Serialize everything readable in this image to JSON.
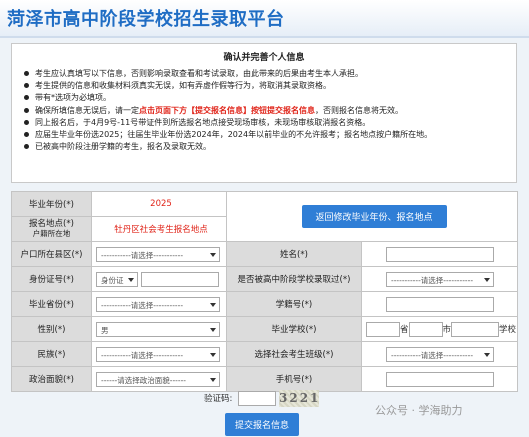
{
  "header": {
    "title": "菏泽市高中阶段学校招生录取平台"
  },
  "notice": {
    "title": "确认并完善个人信息",
    "items": [
      {
        "text": "考生应认真填写以下信息，否则影响录取查看和考试录取，由此带来的后果由考生本人承担。"
      },
      {
        "text": "考生提供的信息和收集材料须真实无误，如有弄虚作假等行为，将取消其录取资格。"
      },
      {
        "text": "带有*选项为必填项。"
      },
      {
        "pre": "确保所填信息无误后，请一定",
        "highlight": "点击页面下方【提交报名信息】按钮提交报名信息",
        "post": "，否则报名信息将无效。"
      },
      {
        "text": "同上报名后，于4月9号-11号带证件到所选报名地点接受现场审核，未现场审核取消报名资格。"
      },
      {
        "text": "应届生毕业年份选2025；往届生毕业年份选2024年，2024年以前毕业的不允许报考；报名地点按户籍所在地。"
      },
      {
        "text": "已被高中阶段注册学籍的考生，报名及录取无效。"
      }
    ]
  },
  "form": {
    "grad_year_label": "毕业年份(*)",
    "grad_year_value": "2025",
    "site_label": "报名地点(*)",
    "site_sub": "户籍所在地",
    "site_value": "牡丹区社会考生报名地点",
    "back_button": "返回修改毕业年份、报名地点",
    "hukou_label": "户口所在县区(*)",
    "hukou_select": "-----------请选择-----------",
    "name_label": "姓名(*)",
    "id_label": "身份证号(*)",
    "id_type": "身份证",
    "registered_label": "是否被高中阶段学校录取过(*)",
    "registered_select": "-----------请选择-----------",
    "province_label": "毕业省份(*)",
    "province_select": "-----------请选择-----------",
    "student_no_label": "学籍号(*)",
    "gender_label": "性别(*)",
    "gender_value": "男",
    "school_label": "毕业学校(*)",
    "school_sheng": "省",
    "school_shi": "市",
    "school_xuexiao": "学校",
    "ethnic_label": "民族(*)",
    "ethnic_select": "-----------请选择-----------",
    "exam_site_label": "选择社会考生班级(*)",
    "exam_site_select": "-----------请选择-----------",
    "politics_label": "政治面貌(*)",
    "politics_select": "------请选择政治面貌------",
    "phone_label": "手机号(*)"
  },
  "captcha": {
    "label": "验证码:",
    "code": "3221"
  },
  "submit_button": "提交报名信息",
  "watermark": "公众号 · 学海助力"
}
